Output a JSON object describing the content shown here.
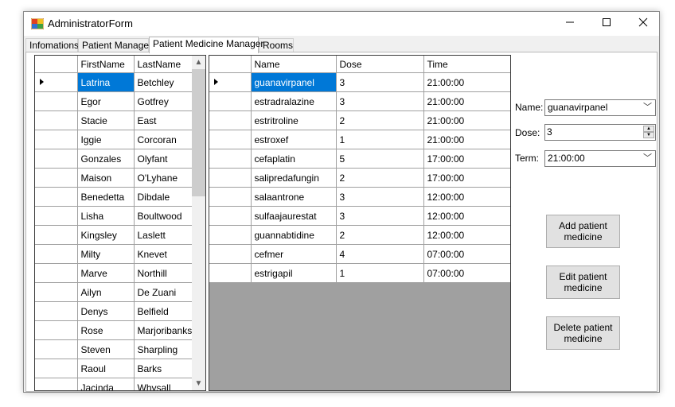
{
  "window": {
    "title": "AdministratorForm"
  },
  "tabs": [
    "Infomations",
    "Patient Manager",
    "Patient Medicine Manager",
    "Rooms"
  ],
  "patients": {
    "columns": [
      "FirstName",
      "LastName"
    ],
    "rows": [
      [
        "Latrina",
        "Betchley"
      ],
      [
        "Egor",
        "Gotfrey"
      ],
      [
        "Stacie",
        "East"
      ],
      [
        "Iggie",
        "Corcoran"
      ],
      [
        "Gonzales",
        "Olyfant"
      ],
      [
        "Maison",
        "O'Lyhane"
      ],
      [
        "Benedetta",
        "Dibdale"
      ],
      [
        "Lisha",
        "Boultwood"
      ],
      [
        "Kingsley",
        "Laslett"
      ],
      [
        "Milty",
        "Knevet"
      ],
      [
        "Marve",
        "Northill"
      ],
      [
        "Ailyn",
        "De Zuani"
      ],
      [
        "Denys",
        "Belfield"
      ],
      [
        "Rose",
        "Marjoribanks"
      ],
      [
        "Steven",
        "Sharpling"
      ],
      [
        "Raoul",
        "Barks"
      ],
      [
        "Jacinda",
        "Whysall"
      ]
    ]
  },
  "medicines": {
    "columns": [
      "Name",
      "Dose",
      "Time"
    ],
    "rows": [
      [
        "guanavirpanel",
        "3",
        "21:00:00"
      ],
      [
        "estradralazine",
        "3",
        "21:00:00"
      ],
      [
        "estritroline",
        "2",
        "21:00:00"
      ],
      [
        "estroxef",
        "1",
        "21:00:00"
      ],
      [
        "cefaplatin",
        "5",
        "17:00:00"
      ],
      [
        "salipredafungin",
        "2",
        "17:00:00"
      ],
      [
        "salaantrone",
        "3",
        "12:00:00"
      ],
      [
        "sulfaajaurestat",
        "3",
        "12:00:00"
      ],
      [
        "guannabtidine",
        "2",
        "12:00:00"
      ],
      [
        "cefmer",
        "4",
        "07:00:00"
      ],
      [
        "estrigapil",
        "1",
        "07:00:00"
      ]
    ]
  },
  "form": {
    "name_label": "Name:",
    "name_value": "guanavirpanel",
    "dose_label": "Dose:",
    "dose_value": "3",
    "term_label": "Term:",
    "term_value": "21:00:00"
  },
  "buttons": {
    "add": "Add patient medicine",
    "edit": "Edit patient medicine",
    "delete": "Delete patient medicine"
  },
  "colors": {
    "selection": "#0078d7",
    "grid_background": "#a0a0a0"
  }
}
